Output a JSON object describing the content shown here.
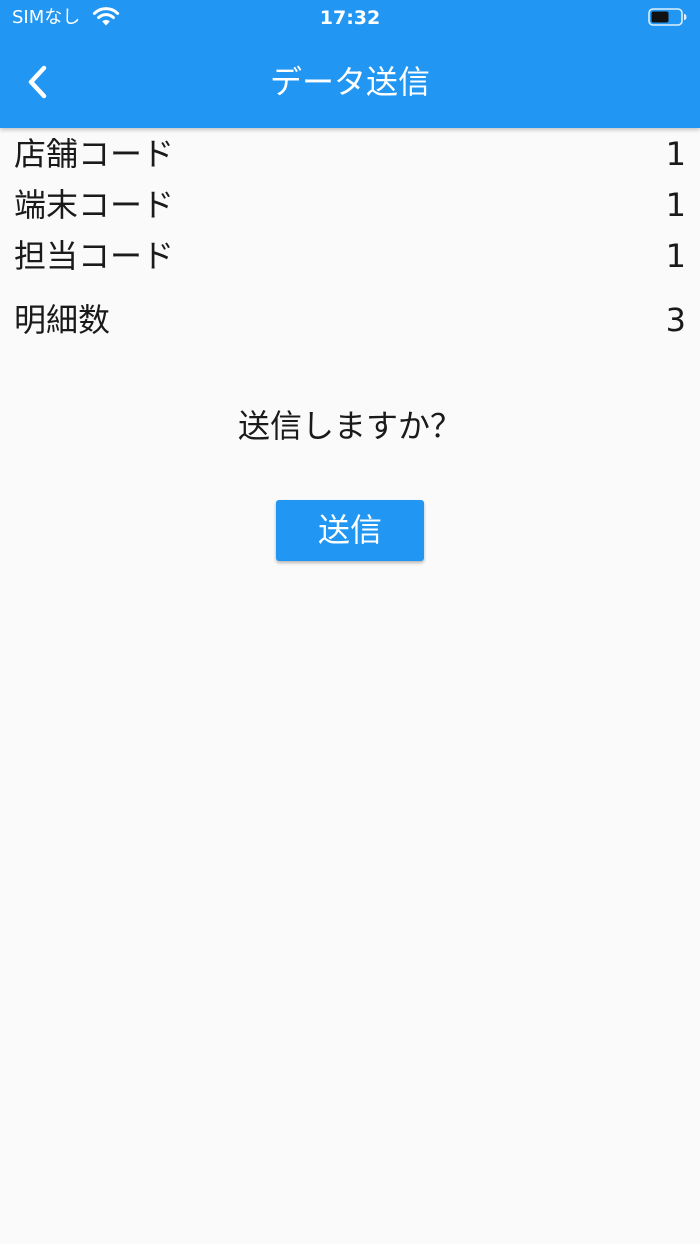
{
  "status_bar": {
    "carrier": "SIMなし",
    "time": "17:32",
    "wifi_icon": "wifi-icon",
    "battery_icon": "battery-icon"
  },
  "app_bar": {
    "title": "データ送信",
    "back_icon": "chevron-left-icon",
    "background_color": "#2196f3"
  },
  "info": {
    "rows": [
      {
        "label": "店舗コード",
        "value": "1"
      },
      {
        "label": "端末コード",
        "value": "1"
      },
      {
        "label": "担当コード",
        "value": "1"
      },
      {
        "label": "明細数",
        "value": "3"
      }
    ]
  },
  "confirm": {
    "message": "送信しますか？",
    "send_label": "送信"
  },
  "colors": {
    "accent": "#2196f3",
    "background": "#fafafa",
    "text": "#1a1a1a"
  }
}
